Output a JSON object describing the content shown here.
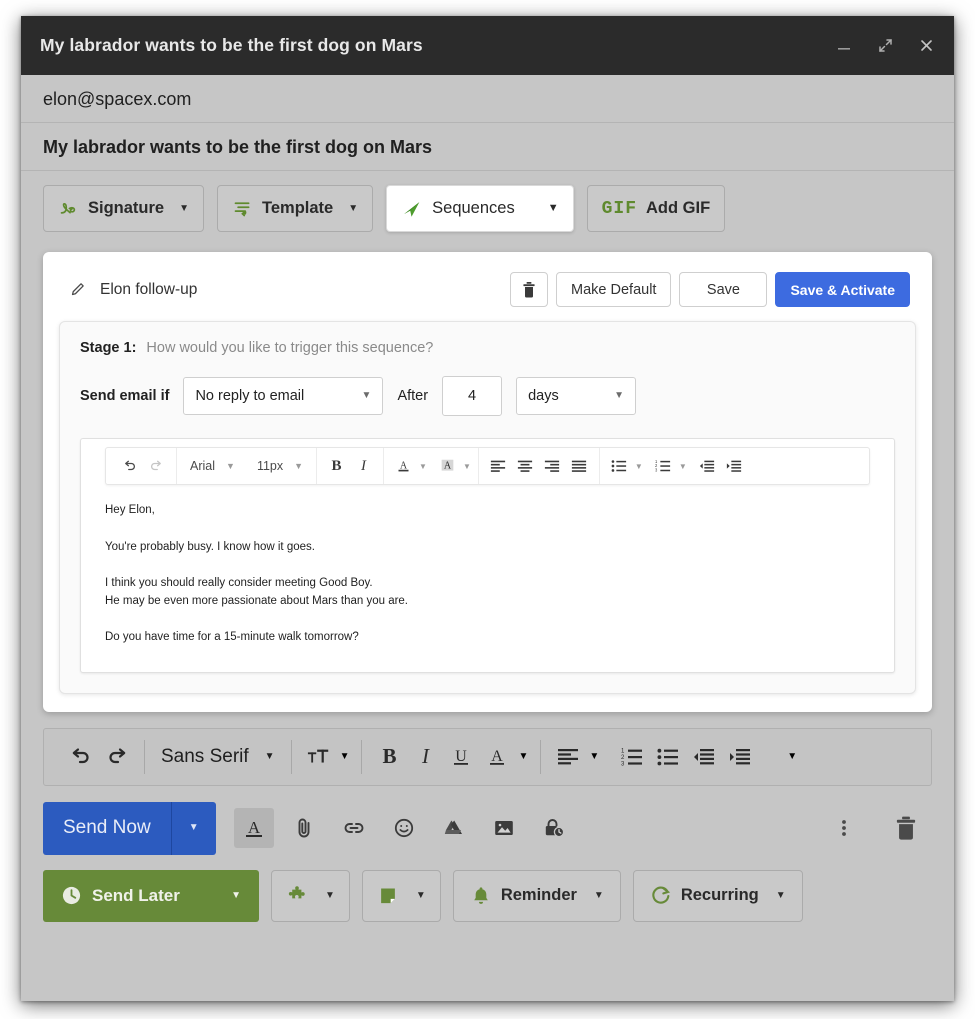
{
  "window": {
    "title": "My labrador wants to be the first dog on Mars",
    "controls": {
      "minimize": "minimize-icon",
      "expand": "expand-icon",
      "close": "close-icon"
    }
  },
  "compose": {
    "to": "elon@spacex.com",
    "subject": "My labrador wants to be the first dog on Mars"
  },
  "plugin_bar": {
    "signature": "Signature",
    "template": "Template",
    "sequences": "Sequences",
    "add_gif": "Add GIF",
    "gif_mark": "GIF"
  },
  "sequence": {
    "name": "Elon follow-up",
    "delete": "delete-icon",
    "make_default": "Make Default",
    "save": "Save",
    "save_activate": "Save & Activate",
    "stage": {
      "label": "Stage 1:",
      "question": "How would you like to trigger this sequence?",
      "send_email_if": "Send email if",
      "condition": "No reply to email",
      "after": "After",
      "amount": "4",
      "unit": "days"
    },
    "editor": {
      "font": "Arial",
      "size": "11px",
      "body": [
        {
          "text": "Hey Elon,",
          "tight": false
        },
        {
          "text": "You're probably busy. I know how it goes.",
          "tight": false
        },
        {
          "text": "I think you should really consider meeting Good Boy.",
          "tight": true
        },
        {
          "text": "He may be even more passionate about Mars than you are.",
          "tight": false
        },
        {
          "text": "Do you have time for a 15-minute walk tomorrow?",
          "tight": false
        }
      ]
    }
  },
  "format_bar": {
    "font": "Sans Serif"
  },
  "actions": {
    "send_now": "Send Now",
    "send_later": "Send Later",
    "reminder": "Reminder",
    "recurring": "Recurring"
  },
  "colors": {
    "titlebar": "#2b2b2b",
    "window_bg": "#c6c6c6",
    "accent_green": "#678a39",
    "accent_blue": "#2c5bbf",
    "primary_blue": "#3d6be0",
    "icon_green": "#5f8a2e"
  }
}
